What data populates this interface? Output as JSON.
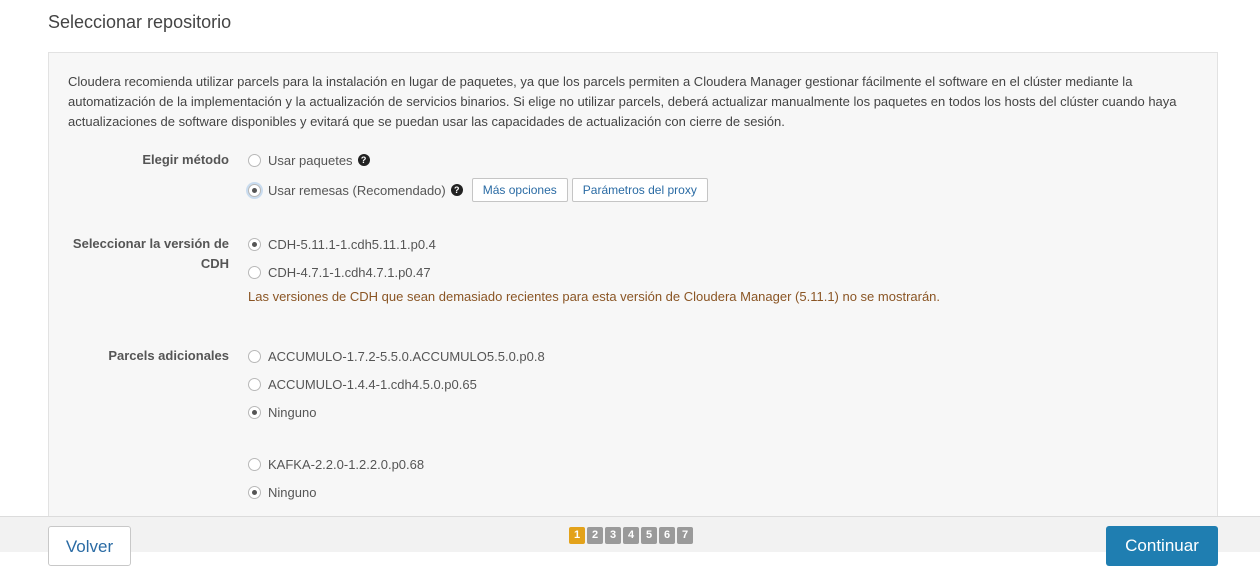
{
  "page_title": "Seleccionar repositorio",
  "intro": "Cloudera recomienda utilizar parcels para la instalación en lugar de paquetes, ya que los parcels permiten a Cloudera Manager gestionar fácilmente el software en el clúster mediante la automatización de la implementación y la actualización de servicios binarios. Si elige no utilizar parcels, deberá actualizar manualmente los paquetes en todos los hosts del clúster cuando haya actualizaciones de software disponibles y evitará que se puedan usar las capacidades de actualización con cierre de sesión.",
  "method": {
    "label": "Elegir método",
    "options": [
      {
        "label": "Usar paquetes",
        "selected": false
      },
      {
        "label": "Usar remesas (Recomendado)",
        "selected": true
      }
    ],
    "more_options": "Más opciones",
    "proxy_settings": "Parámetros del proxy",
    "help_glyph": "?"
  },
  "cdh": {
    "label_line1": "Seleccionar la versión de",
    "label_line2": "CDH",
    "options": [
      {
        "label": "CDH-5.11.1-1.cdh5.11.1.p0.4",
        "selected": true
      },
      {
        "label": "CDH-4.7.1-1.cdh4.7.1.p0.47",
        "selected": false
      }
    ],
    "warning": "Las versiones de CDH que sean demasiado recientes para esta versión de Cloudera Manager (5.11.1) no se mostrarán."
  },
  "additional": {
    "label": "Parcels adicionales",
    "accumulo": [
      {
        "label": "ACCUMULO-1.7.2-5.5.0.ACCUMULO5.5.0.p0.8",
        "selected": false
      },
      {
        "label": "ACCUMULO-1.4.4-1.cdh4.5.0.p0.65",
        "selected": false
      },
      {
        "label": "Ninguno",
        "selected": true
      }
    ],
    "kafka": [
      {
        "label": "KAFKA-2.2.0-1.2.2.0.p0.68",
        "selected": false
      },
      {
        "label": "Ninguno",
        "selected": true
      }
    ]
  },
  "footer": {
    "back": "Volver",
    "next": "Continuar",
    "steps": [
      "1",
      "2",
      "3",
      "4",
      "5",
      "6",
      "7"
    ],
    "current_step": 1
  },
  "colors": {
    "accent": "#1f7eb1",
    "warning_text": "#8a5524",
    "active_step": "#e3a21a"
  }
}
